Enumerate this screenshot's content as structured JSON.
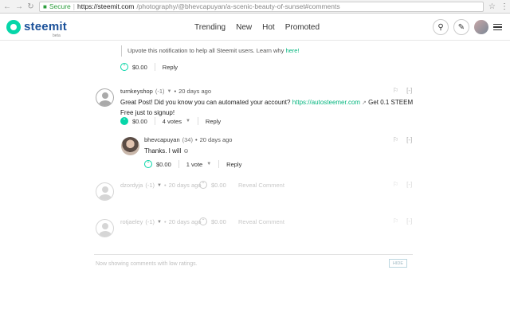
{
  "browser": {
    "secure_label": "Secure",
    "url_host": "https://steemit.com",
    "url_path": "/photography/@bhevcapuyan/a-scenic-beauty-of-sunset#comments"
  },
  "header": {
    "logo_text": "steemit",
    "logo_beta": "beta",
    "nav": [
      "Trending",
      "New",
      "Hot",
      "Promoted"
    ]
  },
  "notice": {
    "text": "Upvote this notification to help all Steemit users. Learn why ",
    "link": "here!",
    "payout": "$0.00",
    "reply": "Reply"
  },
  "comments": [
    {
      "author": "turnkeyshop",
      "rep": "(-1)",
      "time": "20 days ago",
      "body_pre": "Great Post! Did you know you can automated your account? ",
      "body_link": "https://autosteemer.com",
      "body_post": " Get 0.1 STEEM Free just to signup!",
      "payout": "$0.00",
      "votes": "4 votes",
      "reply": "Reply",
      "collapse": "[-]"
    },
    {
      "author": "bhevcapuyan",
      "rep": "(34)",
      "time": "20 days ago",
      "body": "Thanks. I will ☺",
      "payout": "$0.00",
      "votes": "1 vote",
      "reply": "Reply",
      "collapse": "[-]"
    },
    {
      "author": "dzordyja",
      "rep": "(-1)",
      "time": "20 days ago",
      "payout": "$0.00",
      "reveal": "Reveal Comment",
      "collapse": "[-]"
    },
    {
      "author": "rotjaeley",
      "rep": "(-1)",
      "time": "20 days ago",
      "payout": "$0.00",
      "reveal": "Reveal Comment",
      "collapse": "[-]"
    }
  ],
  "footer": {
    "low_ratings": "Now showing comments with low ratings.",
    "hide": "HIDE"
  }
}
